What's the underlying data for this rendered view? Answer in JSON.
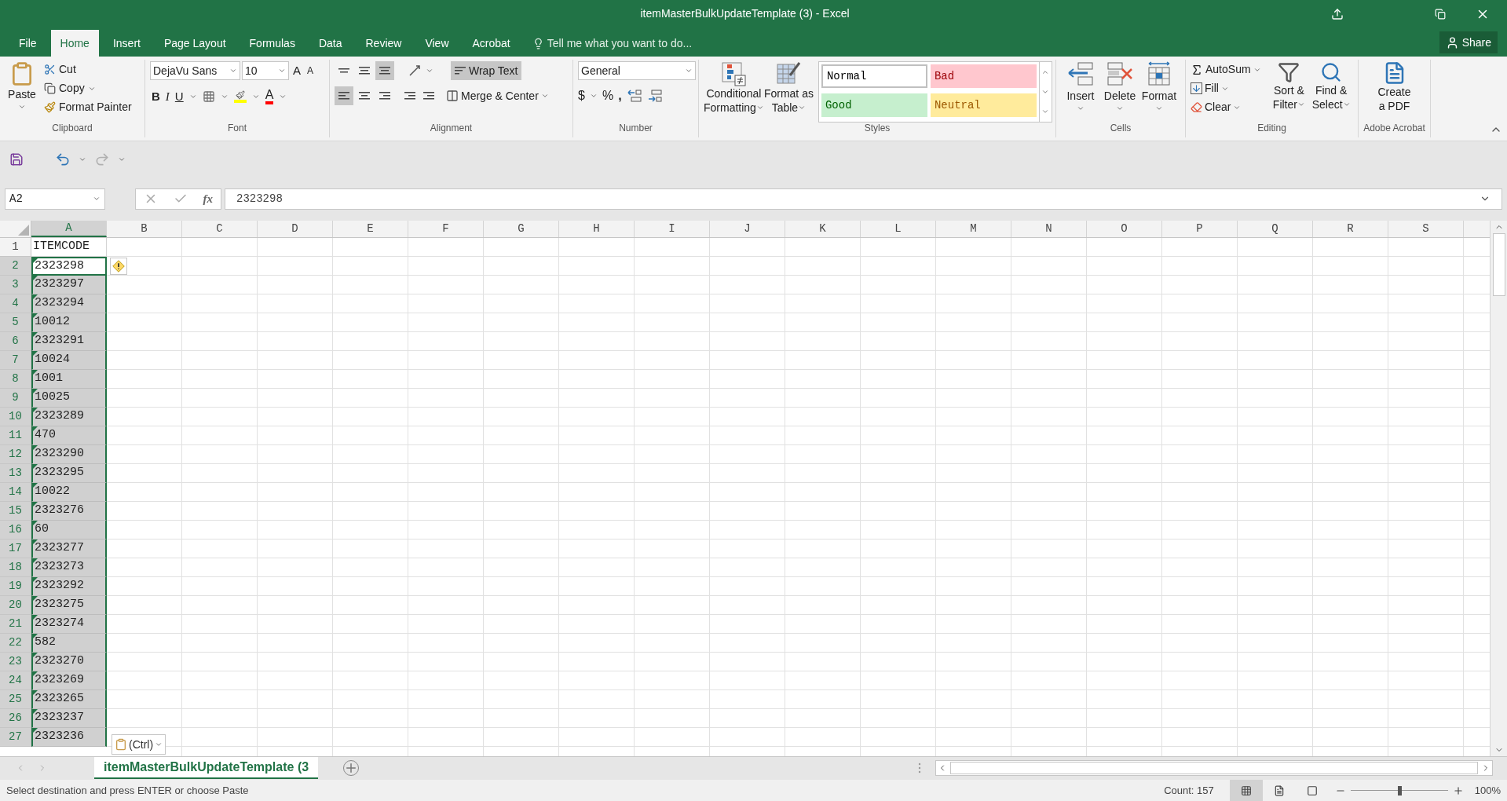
{
  "window": {
    "title": "itemMasterBulkUpdateTemplate (3) - Excel"
  },
  "menu_tabs": [
    {
      "label": "File",
      "selected": false
    },
    {
      "label": "Home",
      "selected": true
    },
    {
      "label": "Insert",
      "selected": false
    },
    {
      "label": "Page Layout",
      "selected": false
    },
    {
      "label": "Formulas",
      "selected": false
    },
    {
      "label": "Data",
      "selected": false
    },
    {
      "label": "Review",
      "selected": false
    },
    {
      "label": "View",
      "selected": false
    },
    {
      "label": "Acrobat",
      "selected": false
    }
  ],
  "tell_me": {
    "placeholder": "Tell me what you want to do..."
  },
  "share": "Share",
  "clipboard": {
    "label": "Clipboard",
    "paste": "Paste",
    "cut": "Cut",
    "copy": "Copy",
    "format_painter": "Format Painter"
  },
  "font": {
    "label": "Font",
    "family": "DejaVu Sans",
    "size": "10",
    "grow": "A",
    "shrink": "A",
    "bold": "B",
    "italic": "I",
    "underline": "U",
    "font_color": "A"
  },
  "alignment": {
    "label": "Alignment",
    "vertical": [
      {
        "selected": false
      },
      {
        "selected": false
      },
      {
        "selected": true
      }
    ],
    "horizontal": [
      {
        "selected": true
      },
      {
        "selected": false
      },
      {
        "selected": false
      }
    ],
    "wrap_text": {
      "label": "Wrap Text",
      "selected": true
    },
    "merge": "Merge & Center"
  },
  "number": {
    "label": "Number",
    "format": "General",
    "currency": "$",
    "percent": "%",
    "comma": ","
  },
  "styles": {
    "label": "Styles",
    "conditional": [
      "Conditional",
      "Formatting"
    ],
    "format_table": [
      "Format as",
      "Table"
    ],
    "cell_styles": [
      {
        "label": "Normal",
        "kind": "normal"
      },
      {
        "label": "Bad",
        "kind": "bad"
      },
      {
        "label": "Good",
        "kind": "good"
      },
      {
        "label": "Neutral",
        "kind": "neutral"
      }
    ]
  },
  "cells": {
    "label": "Cells",
    "buttons": [
      {
        "label": "Insert",
        "kind": "insert"
      },
      {
        "label": "Delete",
        "kind": "delete"
      },
      {
        "label": "Format",
        "kind": "format"
      }
    ]
  },
  "editing": {
    "label": "Editing",
    "autosum": "AutoSum",
    "fill": "Fill",
    "clear": "Clear",
    "sort": [
      "Sort &",
      "Filter"
    ],
    "find": [
      "Find &",
      "Select"
    ]
  },
  "acrobat": {
    "label": "Adobe Acrobat",
    "create": [
      "Create",
      "a PDF"
    ]
  },
  "formula_bar": {
    "name_box": "A2",
    "fx": "fx",
    "value": "2323298"
  },
  "columns": [
    {
      "label": "A",
      "selected": true
    },
    {
      "label": "B",
      "selected": false
    },
    {
      "label": "C",
      "selected": false
    },
    {
      "label": "D",
      "selected": false
    },
    {
      "label": "E",
      "selected": false
    },
    {
      "label": "F",
      "selected": false
    },
    {
      "label": "G",
      "selected": false
    },
    {
      "label": "H",
      "selected": false
    },
    {
      "label": "I",
      "selected": false
    },
    {
      "label": "J",
      "selected": false
    },
    {
      "label": "K",
      "selected": false
    },
    {
      "label": "L",
      "selected": false
    },
    {
      "label": "M",
      "selected": false
    },
    {
      "label": "N",
      "selected": false
    },
    {
      "label": "O",
      "selected": false
    },
    {
      "label": "P",
      "selected": false
    },
    {
      "label": "Q",
      "selected": false
    },
    {
      "label": "R",
      "selected": false
    },
    {
      "label": "S",
      "selected": false
    }
  ],
  "rows": [
    {
      "number": "1",
      "value": "ITEMCODE",
      "selected": false,
      "active": false,
      "flagged": false
    },
    {
      "number": "2",
      "value": "2323298",
      "selected": true,
      "active": true,
      "flagged": true
    },
    {
      "number": "3",
      "value": "2323297",
      "selected": true,
      "active": false,
      "flagged": true
    },
    {
      "number": "4",
      "value": "2323294",
      "selected": true,
      "active": false,
      "flagged": true
    },
    {
      "number": "5",
      "value": "10012",
      "selected": true,
      "active": false,
      "flagged": true
    },
    {
      "number": "6",
      "value": "2323291",
      "selected": true,
      "active": false,
      "flagged": true
    },
    {
      "number": "7",
      "value": "10024",
      "selected": true,
      "active": false,
      "flagged": true
    },
    {
      "number": "8",
      "value": "1001",
      "selected": true,
      "active": false,
      "flagged": true
    },
    {
      "number": "9",
      "value": "10025",
      "selected": true,
      "active": false,
      "flagged": true
    },
    {
      "number": "10",
      "value": "2323289",
      "selected": true,
      "active": false,
      "flagged": true
    },
    {
      "number": "11",
      "value": "470",
      "selected": true,
      "active": false,
      "flagged": true
    },
    {
      "number": "12",
      "value": "2323290",
      "selected": true,
      "active": false,
      "flagged": true
    },
    {
      "number": "13",
      "value": "2323295",
      "selected": true,
      "active": false,
      "flagged": true
    },
    {
      "number": "14",
      "value": "10022",
      "selected": true,
      "active": false,
      "flagged": true
    },
    {
      "number": "15",
      "value": "2323276",
      "selected": true,
      "active": false,
      "flagged": true
    },
    {
      "number": "16",
      "value": "60",
      "selected": true,
      "active": false,
      "flagged": true
    },
    {
      "number": "17",
      "value": "2323277",
      "selected": true,
      "active": false,
      "flagged": true
    },
    {
      "number": "18",
      "value": "2323273",
      "selected": true,
      "active": false,
      "flagged": true
    },
    {
      "number": "19",
      "value": "2323292",
      "selected": true,
      "active": false,
      "flagged": true
    },
    {
      "number": "20",
      "value": "2323275",
      "selected": true,
      "active": false,
      "flagged": true
    },
    {
      "number": "21",
      "value": "2323274",
      "selected": true,
      "active": false,
      "flagged": true
    },
    {
      "number": "22",
      "value": "582",
      "selected": true,
      "active": false,
      "flagged": true
    },
    {
      "number": "23",
      "value": "2323270",
      "selected": true,
      "active": false,
      "flagged": true
    },
    {
      "number": "24",
      "value": "2323269",
      "selected": true,
      "active": false,
      "flagged": true
    },
    {
      "number": "25",
      "value": "2323265",
      "selected": true,
      "active": false,
      "flagged": true
    },
    {
      "number": "26",
      "value": "2323237",
      "selected": true,
      "active": false,
      "flagged": true
    },
    {
      "number": "27",
      "value": "2323236",
      "selected": true,
      "active": false,
      "flagged": true
    }
  ],
  "paste_options": "(Ctrl)",
  "sheet_tabs": [
    {
      "label": "itemMasterBulkUpdateTemplate (3",
      "selected": true
    }
  ],
  "status_bar": {
    "message": "Select destination and press ENTER or choose Paste",
    "count": "Count: 157",
    "views": [
      {
        "kind": "normal",
        "selected": true
      },
      {
        "kind": "page_layout",
        "selected": false
      },
      {
        "kind": "page_break",
        "selected": false
      }
    ],
    "zoom": "100%",
    "zoom_slider": {
      "level": 0.5
    }
  }
}
